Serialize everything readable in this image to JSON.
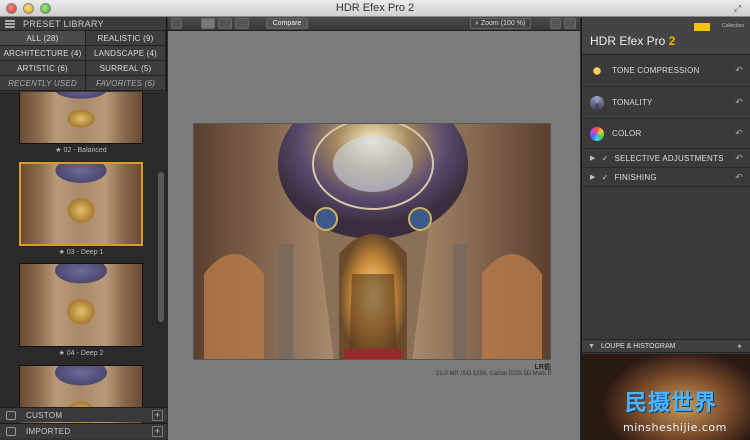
{
  "window": {
    "title": "HDR Efex Pro 2"
  },
  "library": {
    "header": "PRESET LIBRARY",
    "categories": [
      {
        "label": "ALL (28)"
      },
      {
        "label": "REALISTIC (9)"
      },
      {
        "label": "ARCHITECTURE (4)"
      },
      {
        "label": "LANDSCAPE (4)"
      },
      {
        "label": "ARTISTIC (6)"
      },
      {
        "label": "SURREAL (5)"
      },
      {
        "label": "RECENTLY USED"
      },
      {
        "label": "FAVORITES (6)"
      }
    ],
    "presets": [
      {
        "label": "★ 02 - Balanced"
      },
      {
        "label": "★ 03 - Deep 1"
      },
      {
        "label": "★ 04 - Deep 2"
      }
    ],
    "custom": "CUSTOM",
    "imported": "IMPORTED",
    "add_symbol": "+"
  },
  "toolbar": {
    "compare": "Compare",
    "zoom": "Zoom (100 %)"
  },
  "image_info": {
    "caption_title": "LR佐",
    "caption_detail": "21.0 MP, ISO 1250, Canon EOS 5D Mark II"
  },
  "right_panel": {
    "title_main": "HDR Efex Pro",
    "title_version": "2",
    "brand_small": "Collection",
    "sections": [
      {
        "label": "TONE COMPRESSION"
      },
      {
        "label": "TONALITY"
      },
      {
        "label": "COLOR"
      },
      {
        "label": "SELECTIVE ADJUSTMENTS"
      },
      {
        "label": "FINISHING"
      }
    ],
    "loupe": "LOUPE & HISTOGRAM",
    "undo_symbol": "↶"
  },
  "watermark": {
    "title": "民摄世界",
    "url": "minsheshijie.com"
  },
  "colors": {
    "accent": "#f4b400",
    "selection": "#d99a2a",
    "watermark": "#4fb4ff"
  },
  "icons": [
    "sun-icon",
    "tonality-icon",
    "color-wheel-icon",
    "menu-icon",
    "pin-icon"
  ]
}
